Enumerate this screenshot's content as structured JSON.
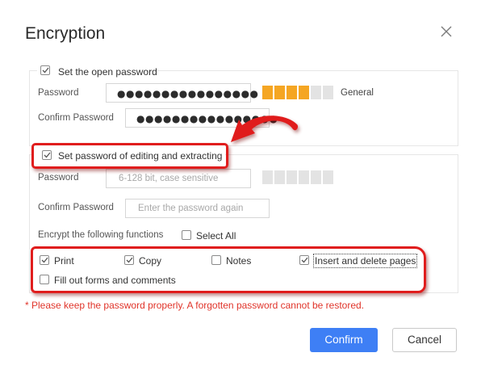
{
  "dialog": {
    "title": "Encryption",
    "close_icon": "close-icon"
  },
  "open_password": {
    "checkbox_label": "Set the open password",
    "checked": true,
    "password_label": "Password",
    "password_value": "●●●●●●●●●●●●●●●●",
    "confirm_label": "Confirm Password",
    "confirm_value": "●●●●●●●●●●●●●●●●",
    "strength": {
      "filled": 4,
      "total": 6,
      "label": "General",
      "color_filled": "#f5a623",
      "color_empty": "#e3e3e3"
    }
  },
  "edit_password": {
    "checkbox_label": "Set password of editing and extracting",
    "checked": true,
    "password_label": "Password",
    "password_placeholder": "6-128 bit, case sensitive",
    "confirm_label": "Confirm Password",
    "confirm_placeholder": "Enter the password again",
    "strength": {
      "filled": 0,
      "total": 6,
      "color_empty": "#e3e3e3"
    },
    "functions_label": "Encrypt the following functions",
    "select_all_label": "Select All",
    "select_all_checked": false,
    "functions": [
      {
        "label": "Print",
        "checked": true
      },
      {
        "label": "Copy",
        "checked": true
      },
      {
        "label": "Notes",
        "checked": false
      },
      {
        "label": "Insert and delete pages",
        "checked": true
      },
      {
        "label": "Fill out forms and comments",
        "checked": false
      }
    ]
  },
  "warning": "*  Please keep the password properly. A forgotten password cannot be restored.",
  "buttons": {
    "confirm": "Confirm",
    "cancel": "Cancel"
  },
  "colors": {
    "accent": "#3e7ff5",
    "annotation": "#e01d1d",
    "warning": "#e0342a"
  }
}
